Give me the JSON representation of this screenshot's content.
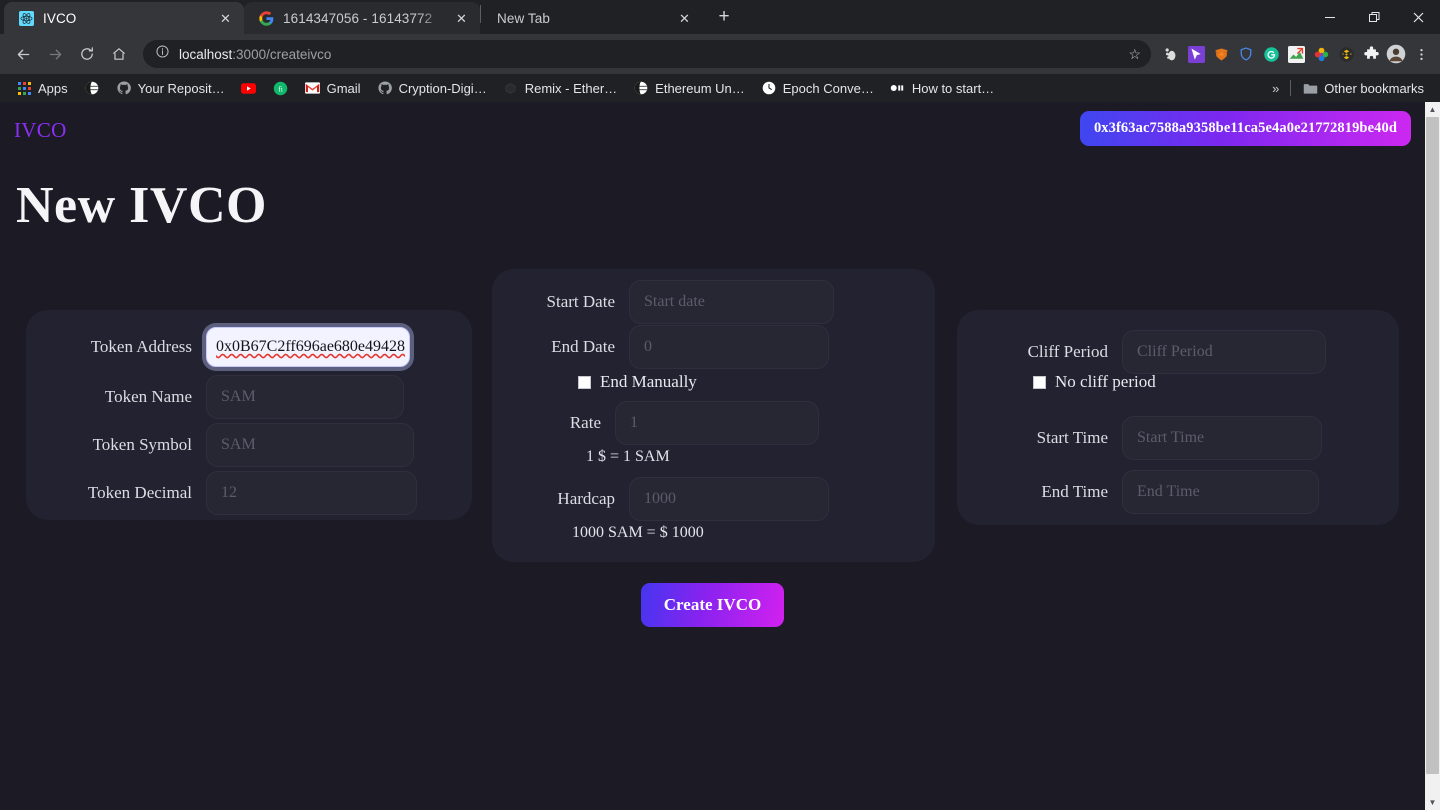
{
  "browser": {
    "tabs": [
      {
        "title": "IVCO",
        "favicon": "react-icon",
        "active": true
      },
      {
        "title": "1614347056 - 16143772",
        "favicon": "google-icon",
        "active": false
      },
      {
        "title": "New Tab",
        "favicon": "none",
        "active": false
      }
    ],
    "newtab_label": "+",
    "close_label": "✕",
    "window_controls": {
      "minimize": "—",
      "maximize": "❐",
      "close": "✕"
    },
    "nav": {
      "back": "←",
      "forward": "→",
      "reload": "⟳",
      "home": "⌂"
    },
    "omnibox": {
      "info_icon": "info-icon",
      "url_host": "localhost",
      "url_path": ":3000/createivco",
      "star_icon": "☆"
    },
    "extensions": [
      "gnome-footprint-icon",
      "purple-cursor-icon",
      "metamask-fox-icon",
      "brave-shield-icon",
      "grammarly-icon",
      "image-editor-icon",
      "color-pinwheel-icon",
      "binance-icon",
      "puzzle-piece-icon",
      "profile-avatar",
      "three-dot-menu-icon"
    ],
    "bookmarks": {
      "apps_label": "Apps",
      "items": [
        {
          "label": "",
          "icon": "globe-icon"
        },
        {
          "label": "Your Reposit…",
          "icon": "github-icon"
        },
        {
          "label": "",
          "icon": "youtube-icon"
        },
        {
          "label": "",
          "icon": "fi-green-icon"
        },
        {
          "label": "Gmail",
          "icon": "gmail-icon"
        },
        {
          "label": "Cryption-Digi…",
          "icon": "github-icon"
        },
        {
          "label": "Remix - Ether…",
          "icon": "remix-icon"
        },
        {
          "label": "Ethereum Un…",
          "icon": "globe-icon"
        },
        {
          "label": "Epoch Conve…",
          "icon": "clock-icon"
        },
        {
          "label": "How to start…",
          "icon": "dots-icon"
        }
      ],
      "overflow_label": "»",
      "other_bookmarks_label": "Other bookmarks",
      "other_bookmarks_icon": "folder-icon"
    }
  },
  "app": {
    "brand": "IVCO",
    "wallet_address": "0x3f63ac7588a9358be11ca5e4a0e21772819be40d",
    "page_title": "New IVCO",
    "accent_gradient_from": "#3f46f0",
    "accent_gradient_to": "#cc28f0",
    "brand_color": "#8b2ff5",
    "background_color": "#1b1a25",
    "card_color": "#232230"
  },
  "token_card": {
    "fields": [
      {
        "label": "Token Address",
        "value": "0x0B67C2ff696ae680e49428",
        "placeholder": "",
        "focused": true,
        "spellcheck_error": true
      },
      {
        "label": "Token Name",
        "value": "",
        "placeholder": "SAM",
        "focused": false
      },
      {
        "label": "Token Symbol",
        "value": "",
        "placeholder": "SAM",
        "focused": false
      },
      {
        "label": "Token Decimal",
        "value": "",
        "placeholder": "12",
        "focused": false
      }
    ]
  },
  "sale_card": {
    "start_date": {
      "label": "Start Date",
      "placeholder": "Start date",
      "value": ""
    },
    "end_date": {
      "label": "End Date",
      "placeholder": "0",
      "value": ""
    },
    "end_manually": {
      "label": "End Manually",
      "checked": false
    },
    "rate": {
      "label": "Rate",
      "placeholder": "1",
      "value": ""
    },
    "rate_note": "1 $ = 1 SAM",
    "hardcap": {
      "label": "Hardcap",
      "placeholder": "1000",
      "value": ""
    },
    "hardcap_note": "1000 SAM = $ 1000"
  },
  "time_card": {
    "cliff_period": {
      "label": "Cliff Period",
      "placeholder": "Cliff Period",
      "value": ""
    },
    "no_cliff": {
      "label": "No cliff period",
      "checked": false
    },
    "start_time": {
      "label": "Start Time",
      "placeholder": "Start Time",
      "value": ""
    },
    "end_time": {
      "label": "End Time",
      "placeholder": "End Time",
      "value": ""
    }
  },
  "submit": {
    "label": "Create IVCO"
  },
  "scrollbar": {
    "up_arrow": "▲",
    "down_arrow": "▼"
  }
}
